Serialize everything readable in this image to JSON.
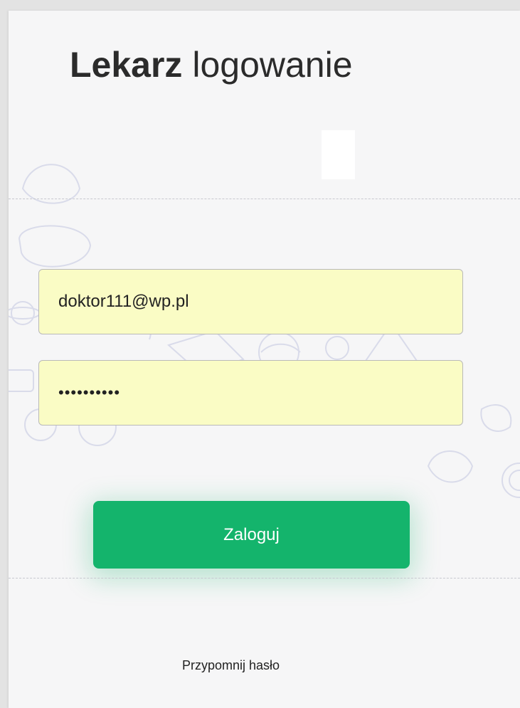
{
  "header": {
    "title_bold": "Lekarz",
    "title_rest": "logowanie"
  },
  "form": {
    "email_value": "doktor111@wp.pl",
    "password_value": "**********",
    "submit_label": "Zaloguj"
  },
  "footer": {
    "remind_label": "Przypomnij hasło"
  },
  "colors": {
    "accent": "#14b46c",
    "autofill_field": "#fafcc5",
    "panel_background": "#f6f6f7"
  },
  "icons": {
    "background": "doodle-pattern"
  }
}
